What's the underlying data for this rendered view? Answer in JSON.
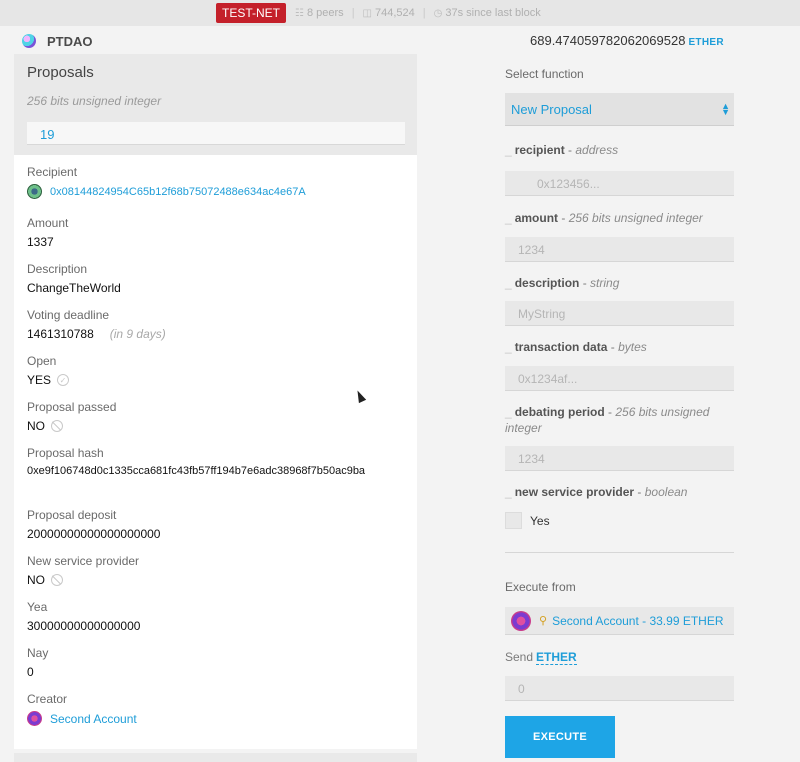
{
  "topbar": {
    "network": "TEST-NET",
    "peers": "8 peers",
    "block": "744,524",
    "since": "37s since last block"
  },
  "contract": {
    "name": "PTDAO",
    "balance": "689.474059782062069528",
    "unit": "ETHER"
  },
  "proposals": {
    "title": "Proposals",
    "subtitle": "256 bits unsigned integer",
    "value": "19",
    "fields": {
      "recipient_label": "Recipient",
      "recipient": "0x08144824954C65b12f68b75072488e634ac4e67A",
      "amount_label": "Amount",
      "amount": "1337",
      "description_label": "Description",
      "description": "ChangeTheWorld",
      "deadline_label": "Voting deadline",
      "deadline": "1461310788",
      "deadline_note": "(in 9 days)",
      "open_label": "Open",
      "open": "YES",
      "passed_label": "Proposal passed",
      "passed": "NO",
      "hash_label": "Proposal hash",
      "hash": "0xe9f106748d0c1335cca681fc43fb57ff194b7e6adc38968f7b50ac9ba",
      "deposit_label": "Proposal deposit",
      "deposit": "20000000000000000000",
      "nsp_label": "New service provider",
      "nsp": "NO",
      "yea_label": "Yea",
      "yea": "30000000000000000",
      "nay_label": "Nay",
      "nay": "0",
      "creator_label": "Creator",
      "creator": "Second Account"
    }
  },
  "form": {
    "select_label": "Select function",
    "selected": "New Proposal",
    "params": [
      {
        "name": "recipient",
        "type": "address",
        "placeholder": "0x123456..."
      },
      {
        "name": "amount",
        "type": "256 bits unsigned integer",
        "placeholder": "1234"
      },
      {
        "name": "description",
        "type": "string",
        "placeholder": "MyString"
      },
      {
        "name": "transaction data",
        "type": "bytes",
        "placeholder": "0x1234af..."
      },
      {
        "name": "debating period",
        "type": "256 bits unsigned integer",
        "placeholder": "1234"
      },
      {
        "name": "new service provider",
        "type": "boolean",
        "checkbox_label": "Yes"
      }
    ],
    "param_sep": " - ",
    "execute_from_label": "Execute from",
    "execute_from": "Second Account - 33.99 ETHER",
    "send_label": "Send",
    "send_unit": "ETHER",
    "send_placeholder": "0",
    "execute_label": "EXECUTE"
  }
}
